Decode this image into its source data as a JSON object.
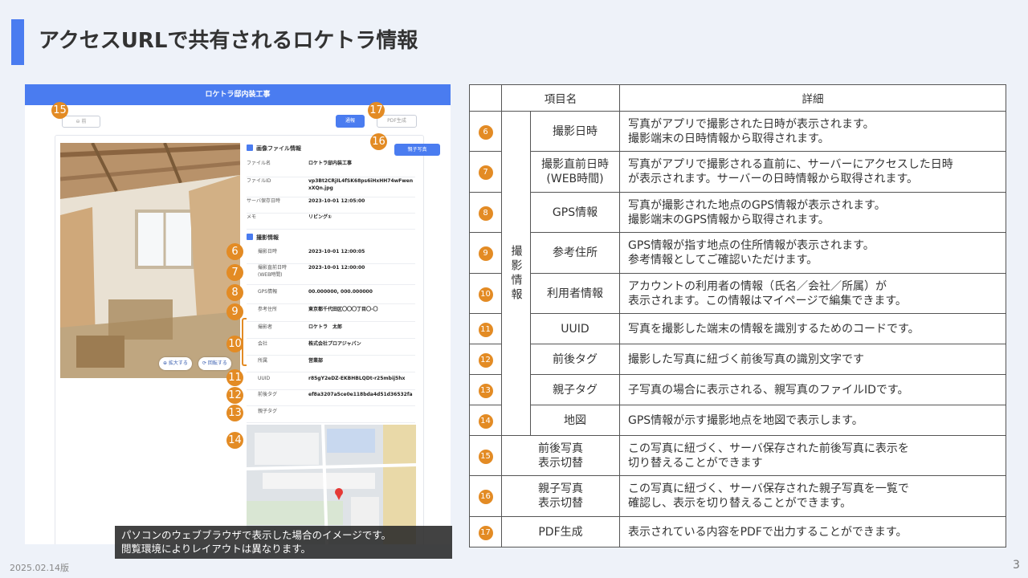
{
  "page": {
    "title": "アクセスURLで共有されるロケトラ情報",
    "date": "2025.02.14版",
    "page_number": "3",
    "accent_color": "#4a7cf0",
    "badge_color": "#e38b24"
  },
  "mock": {
    "header": "ロケトラ邸内装工事",
    "back_button": "⊖ 前",
    "notify_button": "通報",
    "pdf_button": "PDF生成",
    "parent_photo_button": "親子写真",
    "zoom_button": "⊕ 拡大する",
    "rotate_button": "⟳ 回転する",
    "file_section_title": "画像ファイル情報",
    "photo_section_title": "撮影情報",
    "file_rows": [
      {
        "key": "ファイル名",
        "value": "ロケトラ邸内装工事"
      },
      {
        "key": "ファイルID",
        "value": "vp3Bt2CRjIL4fSK68ps6iHxHH74wFwenxXQn.jpg"
      },
      {
        "key": "サーバ保存日時",
        "value": "2023-10-01 12:05:00"
      },
      {
        "key": "メモ",
        "value": "リビング①"
      }
    ],
    "photo_rows": [
      {
        "key": "撮影日時",
        "value": "2023-10-01 12:00:05"
      },
      {
        "key": "撮影直前日時\n(WEB時間)",
        "value": "2023-10-01 12:00:00"
      },
      {
        "key": "GPS情報",
        "value": "00.000000, 000.000000"
      },
      {
        "key": "参考住所",
        "value": "東京都千代田区〇〇〇丁目〇-〇"
      },
      {
        "key": "撮影者",
        "value": "ロケトラ　太郎"
      },
      {
        "key": "会社",
        "value": "株式会社プロアジャパン"
      },
      {
        "key": "所属",
        "value": "営業部"
      },
      {
        "key": "UUID",
        "value": "r85gY2eDZ-EKBHBLQDt-r25mbij5hx"
      },
      {
        "key": "前後タグ",
        "value": "ef8a3207a5ce0e118bda4d51d36532fa"
      },
      {
        "key": "親子タグ",
        "value": ""
      }
    ],
    "badges": [
      "15",
      "17",
      "16",
      "6",
      "7",
      "8",
      "9",
      "10",
      "11",
      "12",
      "13",
      "14"
    ]
  },
  "caption": {
    "line1": "パソコンのウェブブラウザで表示した場合のイメージです。",
    "line2": "閲覧環境によりレイアウトは異なります。"
  },
  "table": {
    "header_item": "項目名",
    "header_detail": "詳細",
    "group_label": "撮影情報",
    "rows": [
      {
        "num": "6",
        "name": "撮影日時",
        "detail": "写真がアプリで撮影された日時が表示されます。\n撮影端末の日時情報から取得されます。"
      },
      {
        "num": "7",
        "name": "撮影直前日時\n(WEB時間)",
        "detail": "写真がアプリで撮影される直前に、サーバーにアクセスした日時\nが表示されます。サーバーの日時情報から取得されます。"
      },
      {
        "num": "8",
        "name": "GPS情報",
        "detail": "写真が撮影された地点のGPS情報が表示されます。\n撮影端末のGPS情報から取得されます。"
      },
      {
        "num": "9",
        "name": "参考住所",
        "detail": "GPS情報が指す地点の住所情報が表示されます。\n参考情報としてご確認いただけます。"
      },
      {
        "num": "10",
        "name": "利用者情報",
        "detail": "アカウントの利用者の情報（氏名／会社／所属）が\n表示されます。この情報はマイページで編集できます。"
      },
      {
        "num": "11",
        "name": "UUID",
        "detail": "写真を撮影した端末の情報を識別するためのコードです。"
      },
      {
        "num": "12",
        "name": "前後タグ",
        "detail": "撮影した写真に紐づく前後写真の識別文字です"
      },
      {
        "num": "13",
        "name": "親子タグ",
        "detail": "子写真の場合に表示される、親写真のファイルIDです。"
      },
      {
        "num": "14",
        "name": "地図",
        "detail": "GPS情報が示す撮影地点を地図で表示します。"
      },
      {
        "num": "15",
        "name": "前後写真\n表示切替",
        "detail": "この写真に紐づく、サーバ保存された前後写真に表示を\n切り替えることができます"
      },
      {
        "num": "16",
        "name": "親子写真\n表示切替",
        "detail": "この写真に紐づく、サーバ保存された親子写真を一覧で\n確認し、表示を切り替えることができます。"
      },
      {
        "num": "17",
        "name": "PDF生成",
        "detail": "表示されている内容をPDFで出力することができます。"
      }
    ]
  }
}
